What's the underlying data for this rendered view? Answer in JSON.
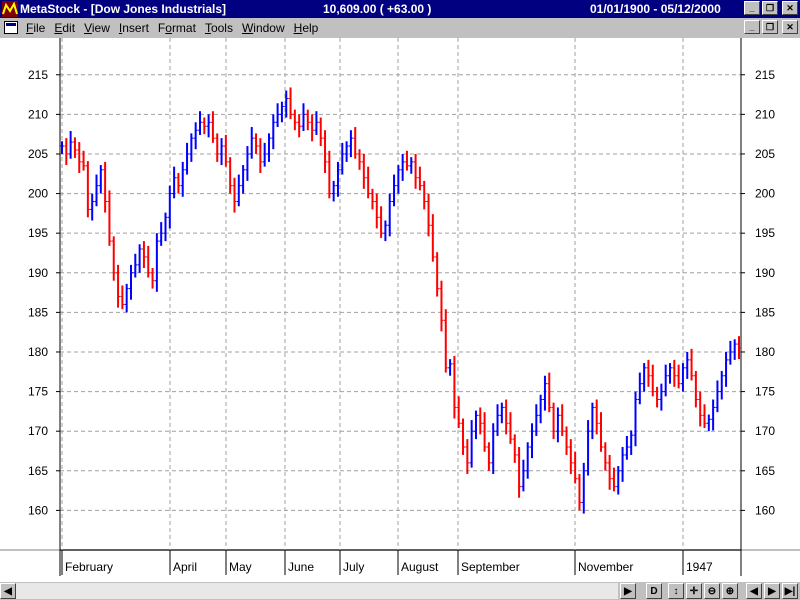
{
  "window": {
    "app_name": "MetaStock",
    "doc_title": "[Dow Jones Industrials]",
    "last_quote": "10,609.00 ( +63.00 )",
    "date_range": "01/01/1900 - 05/12/2000"
  },
  "menu": [
    "File",
    "Edit",
    "View",
    "Insert",
    "Format",
    "Tools",
    "Window",
    "Help"
  ],
  "menu_hotkeys": [
    "F",
    "E",
    "V",
    "I",
    "o",
    "T",
    "W",
    "H"
  ],
  "scrollbar": {
    "buttons": [
      "D",
      "↕",
      "✛",
      "⊖",
      "⊕"
    ]
  },
  "colors": {
    "up": "#0000ff",
    "down": "#ff0000",
    "grid": "#a0a0a0",
    "title_bar": "#000080"
  },
  "chart_data": {
    "type": "bar",
    "style": "ohlc-price-bars",
    "ylim": [
      155,
      218
    ],
    "y_ticks": [
      160,
      165,
      170,
      175,
      180,
      185,
      190,
      195,
      200,
      205,
      210,
      215
    ],
    "x_labels": [
      "February",
      "April",
      "May",
      "June",
      "July",
      "August",
      "September",
      "November",
      "1947"
    ],
    "grid": true,
    "closes": [
      206,
      205,
      206.5,
      205.5,
      204,
      203.5,
      198,
      199,
      201,
      203,
      199,
      194,
      190,
      187,
      186,
      188,
      190,
      191,
      193,
      192,
      190,
      189,
      194,
      195,
      197,
      200,
      202,
      201,
      203,
      205,
      207,
      208,
      209,
      208.5,
      209,
      207,
      205,
      206,
      204,
      201,
      199,
      201,
      203,
      205,
      207,
      206,
      204,
      205,
      207,
      209,
      210,
      211,
      212,
      210,
      209,
      208.5,
      210,
      209,
      208,
      209,
      207,
      204,
      200,
      201,
      203,
      205,
      206,
      207,
      205,
      204,
      202,
      200,
      199,
      197,
      195,
      196,
      199,
      201,
      203,
      204,
      203.5,
      204,
      202,
      201,
      199,
      196,
      192,
      188,
      184,
      178,
      178.5,
      173,
      171,
      168,
      166,
      170,
      172,
      171,
      168,
      166,
      170,
      172,
      173,
      171,
      169,
      167,
      163,
      165,
      168,
      170,
      172,
      174,
      176,
      173,
      170,
      172,
      170,
      168,
      166,
      164,
      161,
      165,
      170,
      173,
      171,
      168,
      166,
      164,
      163,
      165,
      167,
      168,
      169.5,
      174,
      176,
      178,
      177,
      175,
      174,
      175,
      177,
      178,
      177,
      176,
      178,
      179,
      177,
      174,
      172,
      171,
      171.5,
      173,
      175,
      177,
      179,
      180,
      181,
      180.5
    ]
  }
}
